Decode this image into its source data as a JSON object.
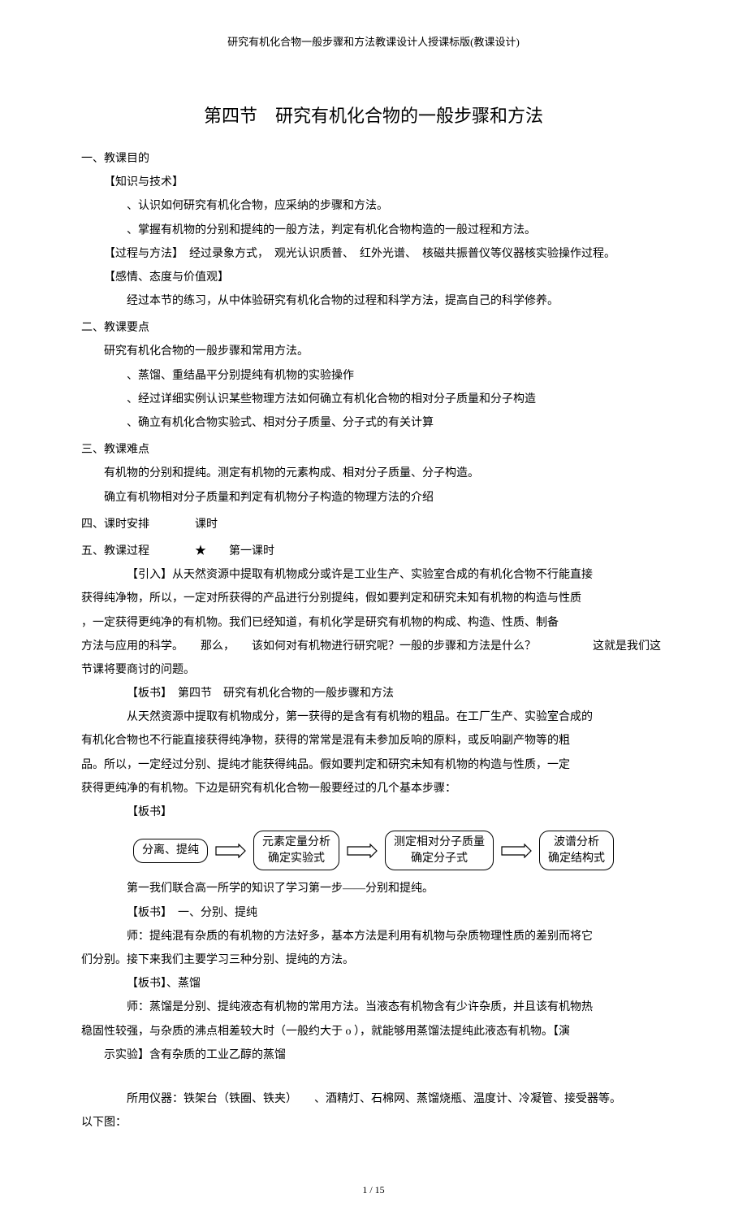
{
  "header": {
    "running_title": "研究有机化合物一般步骤和方法教课设计人授课标版(教课设计)"
  },
  "title": "第四节　研究有机化合物的一般步骤和方法",
  "sec1": {
    "heading": "一、教课目的",
    "sub1": "【知识与技术】",
    "item1": "、认识如何研究有机化合物，应采纳的步骤和方法。",
    "item2": "、掌握有机物的分别和提纯的一般方法，判定有机化合物构造的一般过程和方法。",
    "sub2": "【过程与方法】　经过录象方式，　观光认识质普、　红外光谱、　核磁共振普仪等仪器核实验操作过程。",
    "sub3": "【感情、态度与价值观】",
    "item3": "经过本节的练习，从中体验研究有机化合物的过程和科学方法，提高自己的科学修养。"
  },
  "sec2": {
    "heading": "二、教课要点",
    "item1": "研究有机化合物的一般步骤和常用方法。",
    "item2": "、蒸馏、重结晶平分别提纯有机物的实验操作",
    "item3": "、经过详细实例认识某些物理方法如何确立有机化合物的相对分子质量和分子构造",
    "item4": "、确立有机化合物实验式、相对分子质量、分子式的有关计算"
  },
  "sec3": {
    "heading": "三、教课难点",
    "item1": "有机物的分别和提纯。测定有机物的元素构成、相对分子质量、分子构造。",
    "item2": "确立有机物相对分子质量和判定有机物分子构造的物理方法的介绍"
  },
  "sec4": {
    "heading": "四、课时安排　　　　课时"
  },
  "sec5": {
    "heading": "五、教课过程　　　　★　　第一课时",
    "p1": "【引入】从天然资源中提取有机物成分或许是工业生产、实验室合成的有机化合物不行能直接",
    "p2": "获得纯净物，所以，一定对所获得的产品进行分别提纯，假如要判定和研究未知有机物的构造与性质",
    "p3": "，一定获得更纯净的有机物。我们已经知道，有机化学是研究有机物的构成、构造、性质、制备",
    "p4": "方法与应用的科学。　　那么，　　该如何对有机物进行研究呢？一般的步骤和方法是什么？　　　　　这就是我们这",
    "p5": "节课将要商讨的问题。",
    "board1": "【板书】　第四节　研究有机化合物的一般步骤和方法",
    "p6": "从天然资源中提取有机物成分，第一获得的是含有有机物的粗品。在工厂生产、实验室合成的",
    "p7": "有机化合物也不行能直接获得纯净物，获得的常常是混有未参加反响的原料，或反响副产物等的粗",
    "p8": "品。所以，一定经过分别、提纯才能获得纯品。假如要判定和研究未知有机物的构造与性质，一定",
    "p9": "获得更纯净的有机物。下边是研究有机化合物一般要经过的几个基本步骤：",
    "board2": "【板书】",
    "flow": {
      "box1": "分离、提纯",
      "box2_line1": "元素定量分析",
      "box2_line2": "确定实验式",
      "box3_line1": "测定相对分子质量",
      "box3_line2": "确定分子式",
      "box4_line1": "波谱分析",
      "box4_line2": "确定结构式"
    },
    "p10": "第一我们联合高一所学的知识了学习第一步——分别和提纯。",
    "board3": "【板书】　一、分别、提纯",
    "p11": "师：提纯混有杂质的有机物的方法好多，基本方法是利用有机物与杂质物理性质的差别而将它",
    "p12": "们分别。接下来我们主要学习三种分别、提纯的方法。",
    "board4": "【板书】、蒸馏",
    "p13": "师：蒸馏是分别、提纯液态有机物的常用方法。当液态有机物含有少许杂质，并且该有机物热",
    "p14": "稳固性较强，与杂质的沸点相差较大时（一般约大于 o ），就能够用蒸馏法提纯此液态有机物。【演",
    "p15": "示实验】含有杂质的工业乙醇的蒸馏",
    "p16": "所用仪器：铁架台（铁圈、铁夹）　　、酒精灯、石棉网、蒸馏烧瓶、温度计、冷凝管、接受器等。",
    "p17": "以下图："
  },
  "footer": {
    "page": "1 / 15"
  }
}
